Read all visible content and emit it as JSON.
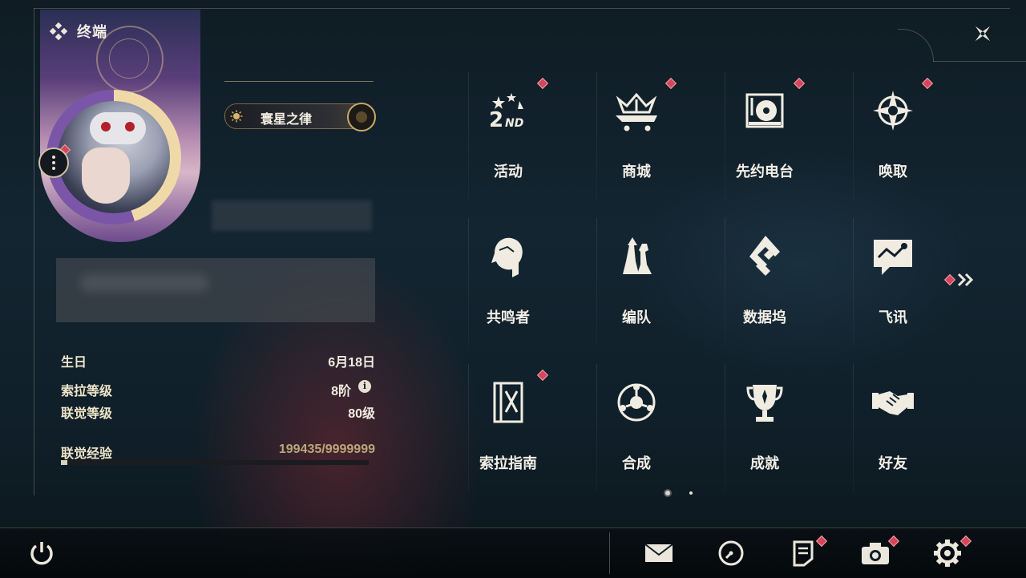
{
  "header": {
    "title": "终端"
  },
  "profile": {
    "name": "寰星之律",
    "stats": [
      {
        "label": "生日",
        "value": "6月18日"
      },
      {
        "label": "索拉等级",
        "value": "8阶"
      },
      {
        "label": "联觉等级",
        "value": "80级"
      }
    ],
    "exp": {
      "label": "联觉经验",
      "value": "199435/9999999",
      "progress": 0.0199
    }
  },
  "menu": [
    {
      "label": "活动",
      "icon": "event-2nd-icon",
      "badge": true
    },
    {
      "label": "商城",
      "icon": "crown-cart-icon",
      "badge": true
    },
    {
      "label": "先约电台",
      "icon": "record-player-icon",
      "badge": true
    },
    {
      "label": "唤取",
      "icon": "compass-star-icon",
      "badge": true
    },
    {
      "label": "共鸣者",
      "icon": "character-head-icon",
      "badge": false
    },
    {
      "label": "编队",
      "icon": "chess-team-icon",
      "badge": false
    },
    {
      "label": "数据坞",
      "icon": "data-dock-icon",
      "badge": false
    },
    {
      "label": "飞讯",
      "icon": "message-bubble-icon",
      "badge": false
    },
    {
      "label": "索拉指南",
      "icon": "guide-book-icon",
      "badge": true
    },
    {
      "label": "合成",
      "icon": "synthesis-orb-icon",
      "badge": false
    },
    {
      "label": "成就",
      "icon": "trophy-icon",
      "badge": false
    },
    {
      "label": "好友",
      "icon": "handshake-icon",
      "badge": false
    }
  ],
  "pagination": {
    "current": 1,
    "total": 2
  },
  "bottom_bar": [
    {
      "name": "power-icon",
      "badge": false
    },
    {
      "name": "mail-icon",
      "badge": false
    },
    {
      "name": "clock-icon",
      "badge": false
    },
    {
      "name": "notice-icon",
      "badge": true
    },
    {
      "name": "camera-icon",
      "badge": true
    },
    {
      "name": "settings-gear-icon",
      "badge": true
    }
  ],
  "colors": {
    "accent_gold": "#c9a96b",
    "badge_red": "#d4465a",
    "text": "#f3efe6"
  }
}
